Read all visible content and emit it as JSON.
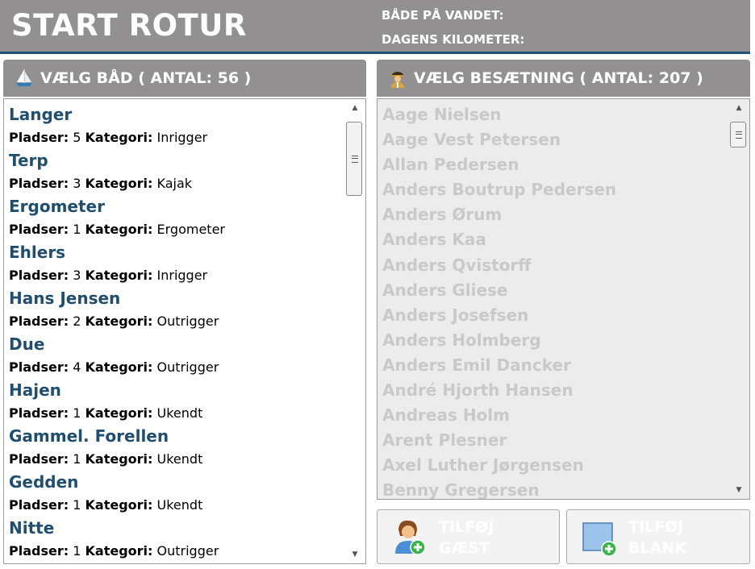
{
  "header": {
    "title": "START ROTUR",
    "info_line1": "BÅDE PÅ VANDET:",
    "info_line2": "DAGENS KILOMETER:"
  },
  "boats_panel": {
    "heading": "VÆLG BÅD ( ANTAL:  56 )",
    "icon": "sailboat-icon",
    "places_label": "Pladser:",
    "category_label": "Kategori:",
    "items": [
      {
        "name": "Langer",
        "places": "5",
        "category": "Inrigger"
      },
      {
        "name": "Terp",
        "places": "3",
        "category": "Kajak"
      },
      {
        "name": "Ergometer",
        "places": "1",
        "category": "Ergometer"
      },
      {
        "name": "Ehlers",
        "places": "3",
        "category": "Inrigger"
      },
      {
        "name": "Hans Jensen",
        "places": "2",
        "category": "Outrigger"
      },
      {
        "name": "Due",
        "places": "4",
        "category": "Outrigger"
      },
      {
        "name": "Hajen",
        "places": "1",
        "category": "Ukendt"
      },
      {
        "name": "Gammel. Forellen",
        "places": "1",
        "category": "Ukendt"
      },
      {
        "name": "Gedden",
        "places": "1",
        "category": "Ukendt"
      },
      {
        "name": "Nitte",
        "places": "1",
        "category": "Outrigger"
      }
    ]
  },
  "crew_panel": {
    "heading": "VÆLG BESÆTNING ( ANTAL:  207 )",
    "icon": "captain-icon",
    "items": [
      "Aage Nielsen",
      "Aage Vest Petersen",
      "Allan Pedersen",
      "Anders Boutrup Pedersen",
      "Anders Ørum",
      "Anders Kaa",
      "Anders Qvistorff",
      "Anders Gliese",
      "Anders Josefsen",
      "Anders Holmberg",
      "Anders Emil Dancker",
      "André Hjorth Hansen",
      "Andreas Holm",
      "Arent Plesner",
      "Axel Luther Jørgensen",
      "Benny Gregersen"
    ]
  },
  "buttons": {
    "add_guest_line1": "TILFØJ",
    "add_guest_line2": "GÆST",
    "add_blank_line1": "TILFØJ",
    "add_blank_line2": "BLANK"
  },
  "colors": {
    "header_bg": "#929090",
    "accent": "#1e5578",
    "boat_name": "#1f4e6e",
    "disabled_text": "#c9c9c9",
    "add_green": "#3bb54a"
  }
}
